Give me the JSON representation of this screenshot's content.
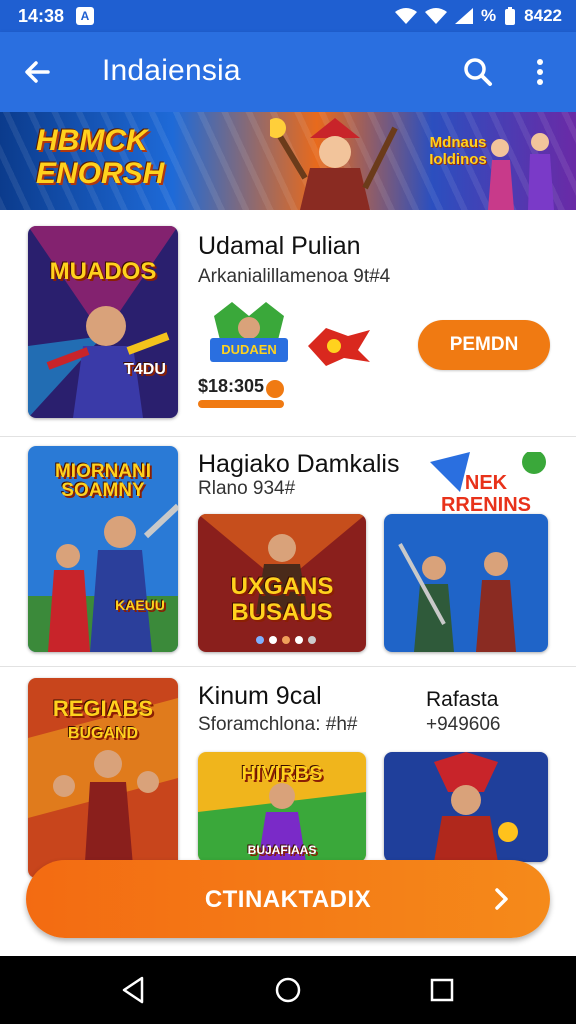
{
  "status_bar": {
    "time": "14:38",
    "app_icon": "A",
    "signal_text": "%",
    "battery_text": "8422"
  },
  "app_bar": {
    "title": "Indaiensia",
    "icons": [
      "back-arrow-icon",
      "search-icon",
      "more-vert-icon"
    ]
  },
  "banner": {
    "title": "HBMCK ENORSH",
    "secondary_title": "Mdnaus Ioldinos"
  },
  "rows": [
    {
      "thumb_label": "MUADOS",
      "thumb_sub": "T4DU",
      "title": "Udamal Pulian",
      "subtitle": "Arkanialillamenoa 9t#4",
      "logo_label": "DUDAEN",
      "button": "PEMDN",
      "price": "$18:305"
    },
    {
      "thumb_label": "MIORNANI SOAMNY",
      "thumb_sub": "KAEUU",
      "title": "Hagiako Damkalis",
      "subtitle": "Rlano 934#",
      "shot1_label": "UXGANS BUSAUS",
      "shot2_label": "NEK RRENINS"
    },
    {
      "thumb_label": "REGIABS",
      "thumb_sub": "BUGAND",
      "title": "Kinum 9cal",
      "subtitle": "Sforamchlona: #h#",
      "side_title": "Rafasta",
      "side_sub": "+949606",
      "shot1_label": "HIVIRBS",
      "shot1_sub": "BUJAFIAAS"
    }
  ],
  "cta": {
    "label": "CTINAKTADIX"
  },
  "colors": {
    "primary": "#2a6fe0",
    "status": "#1f5fd1",
    "accent": "#f07a12"
  }
}
